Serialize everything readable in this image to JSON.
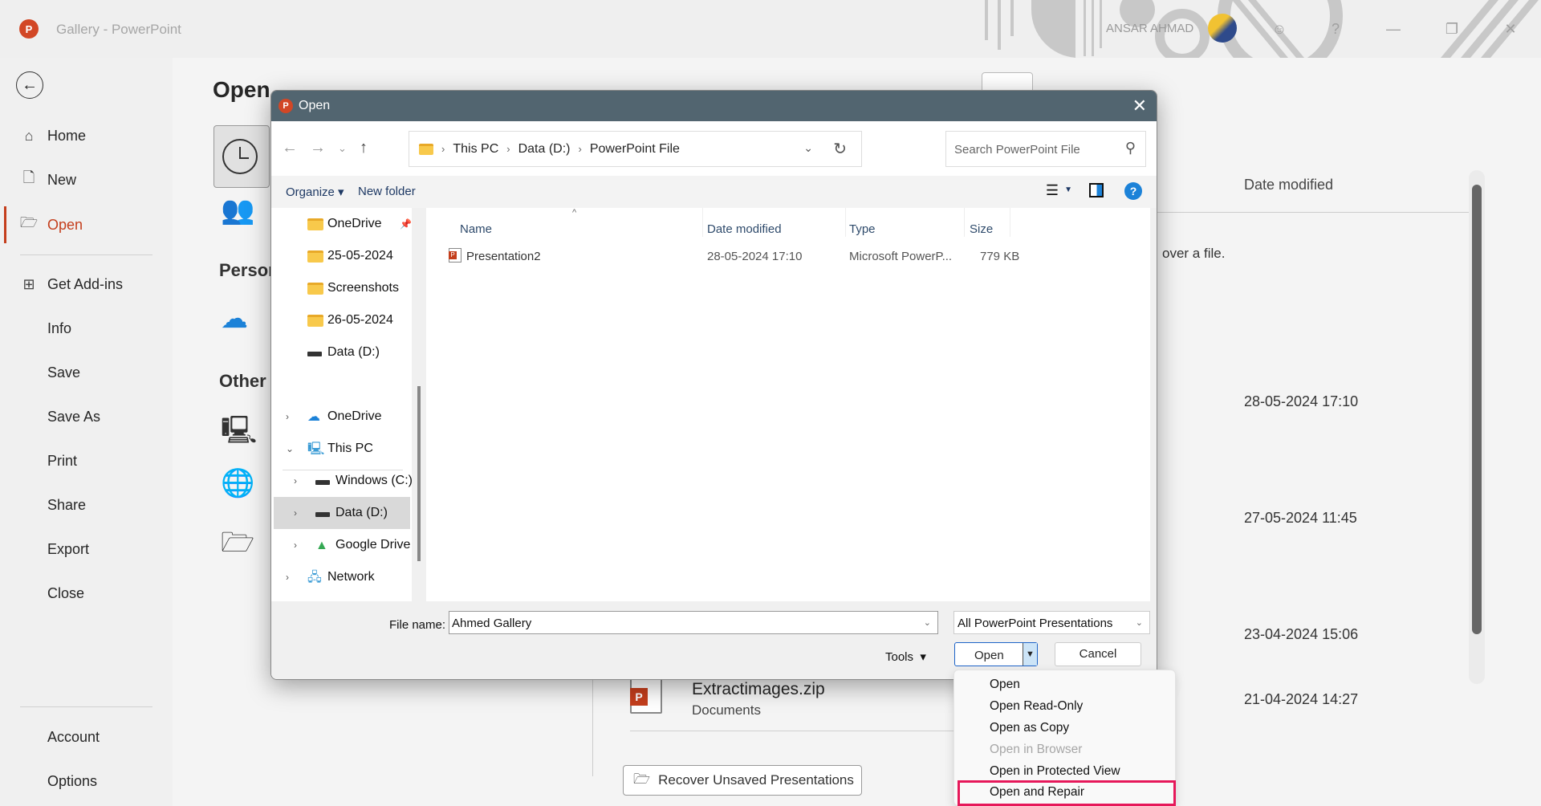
{
  "window": {
    "title": "Gallery  -  PowerPoint",
    "user_name": "ANSAR AHMAD",
    "controls": [
      "minimize",
      "restore",
      "close"
    ]
  },
  "sidebar": {
    "back_icon": "back-arrow-icon",
    "items": [
      {
        "label": "Home",
        "icon": "home-icon"
      },
      {
        "label": "New",
        "icon": "new-document-icon"
      },
      {
        "label": "Open",
        "icon": "open-folder-icon",
        "active": true
      },
      {
        "label": "Get Add-ins",
        "icon": "grid-icon"
      },
      {
        "label": "Info"
      },
      {
        "label": "Save"
      },
      {
        "label": "Save As"
      },
      {
        "label": "Print"
      },
      {
        "label": "Share"
      },
      {
        "label": "Export"
      },
      {
        "label": "Close"
      }
    ],
    "footer": [
      {
        "label": "Account"
      },
      {
        "label": "Options"
      }
    ]
  },
  "backstage": {
    "title": "Open",
    "section_personal": "Personal",
    "section_other": "Other locations",
    "column_date": "Date modified",
    "hint": "over a file.",
    "dates": [
      "28-05-2024 17:10",
      "27-05-2024 11:45",
      "23-04-2024 15:06",
      "21-04-2024 14:27"
    ],
    "recent_file": {
      "name": "Extractimages.zip",
      "location": "Documents"
    },
    "recover_button": "Recover Unsaved Presentations"
  },
  "dialog": {
    "title": "Open",
    "breadcrumb": [
      "This PC",
      "Data (D:)",
      "PowerPoint File"
    ],
    "search_placeholder": "Search PowerPoint File",
    "toolbar": {
      "organize": "Organize",
      "new_folder": "New folder"
    },
    "tree": {
      "quick_access": [
        "OneDrive",
        "25-05-2024",
        "Screenshots",
        "26-05-2024",
        "Data (D:)"
      ],
      "onedrive": "OneDrive",
      "this_pc": "This PC",
      "windows_c": "Windows (C:)",
      "data_d": "Data (D:)",
      "google_drive": "Google Drive",
      "network": "Network"
    },
    "columns": {
      "name": "Name",
      "date": "Date modified",
      "type": "Type",
      "size": "Size"
    },
    "files": [
      {
        "name": "Presentation2",
        "date": "28-05-2024 17:10",
        "type": "Microsoft PowerP...",
        "size": "779 KB"
      }
    ],
    "file_name_label": "File name:",
    "file_name_value": "Ahmed Gallery",
    "file_type": "All PowerPoint Presentations",
    "tools_label": "Tools",
    "open_label": "Open",
    "cancel_label": "Cancel"
  },
  "open_menu": {
    "items": [
      {
        "label": "Open",
        "enabled": true
      },
      {
        "label": "Open Read-Only",
        "enabled": true
      },
      {
        "label": "Open as Copy",
        "enabled": true
      },
      {
        "label": "Open in Browser",
        "enabled": false
      },
      {
        "label": "Open in Protected View",
        "enabled": true
      },
      {
        "label": "Open and Repair",
        "enabled": true,
        "highlighted": true
      }
    ],
    "highlight_color": "#e6185a"
  }
}
